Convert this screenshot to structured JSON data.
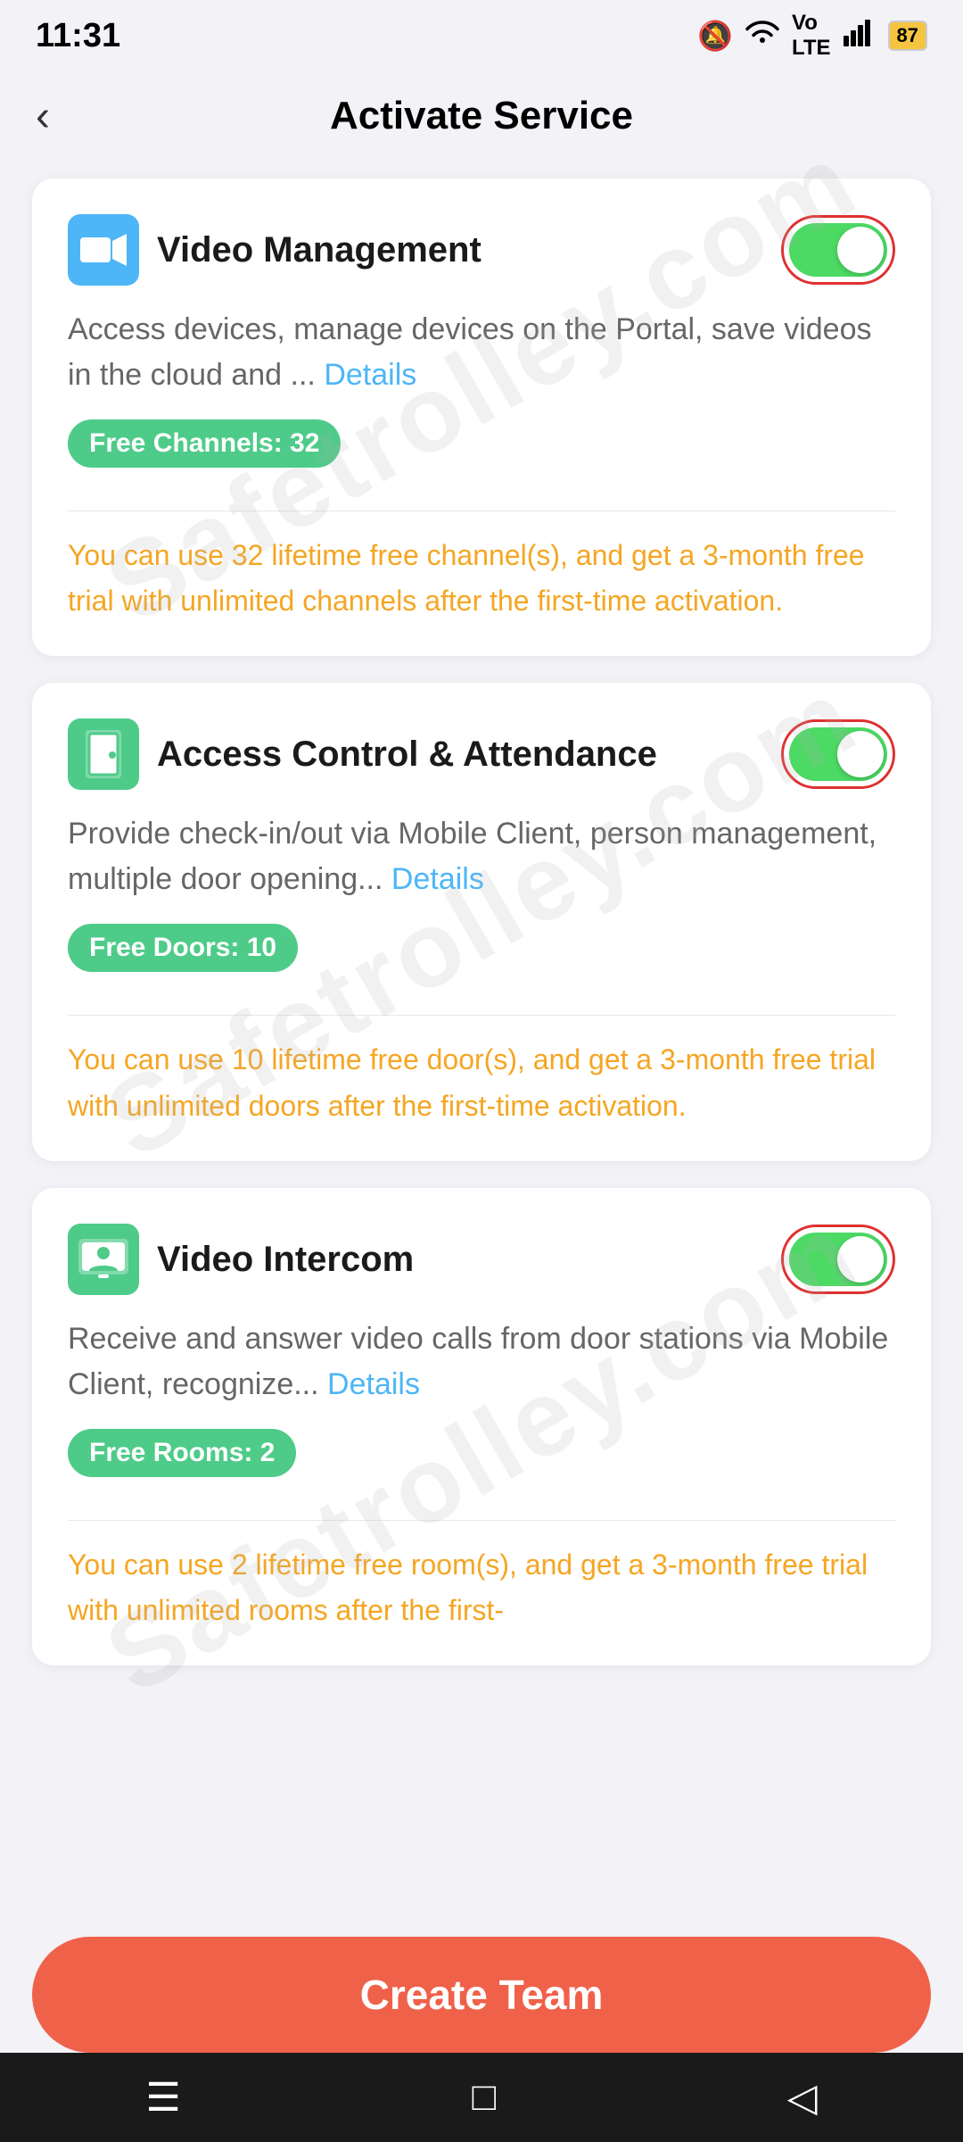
{
  "statusBar": {
    "time": "11:31",
    "batteryLevel": "87",
    "icons": [
      "mute",
      "wifi",
      "volte",
      "signal",
      "battery"
    ]
  },
  "header": {
    "title": "Activate Service",
    "backLabel": "<"
  },
  "services": [
    {
      "id": "video-management",
      "name": "Video Management",
      "iconType": "video",
      "iconColor": "#4db6f7",
      "enabled": true,
      "description": "Access devices, manage devices on the Portal, save videos in the cloud and ...",
      "detailsLabel": "Details",
      "badgeLabel": "Free Channels: 32",
      "infoText": "You can use 32 lifetime free channel(s), and get a 3-month free trial with unlimited channels after the first-time activation."
    },
    {
      "id": "access-control",
      "name": "Access Control & Attendance",
      "iconType": "access",
      "iconColor": "#4ecb89",
      "enabled": true,
      "description": "Provide check-in/out via Mobile Client, person management, multiple door opening...",
      "detailsLabel": "Details",
      "badgeLabel": "Free Doors: 10",
      "infoText": "You can use 10 lifetime free door(s), and get a 3-month free trial with unlimited doors after the first-time activation."
    },
    {
      "id": "video-intercom",
      "name": "Video Intercom",
      "iconType": "intercom",
      "iconColor": "#4ecb89",
      "enabled": true,
      "description": "Receive and answer video calls from door stations via Mobile Client, recognize...",
      "detailsLabel": "Details",
      "badgeLabel": "Free Rooms: 2",
      "infoText": "You can use 2 lifetime free room(s), and get a 3-month free trial with unlimited rooms after the first-"
    }
  ],
  "createTeamButton": {
    "label": "Create Team"
  },
  "watermark": {
    "text": "Safetrolley.com"
  },
  "bottomNav": {
    "items": [
      "menu",
      "home",
      "back"
    ]
  }
}
